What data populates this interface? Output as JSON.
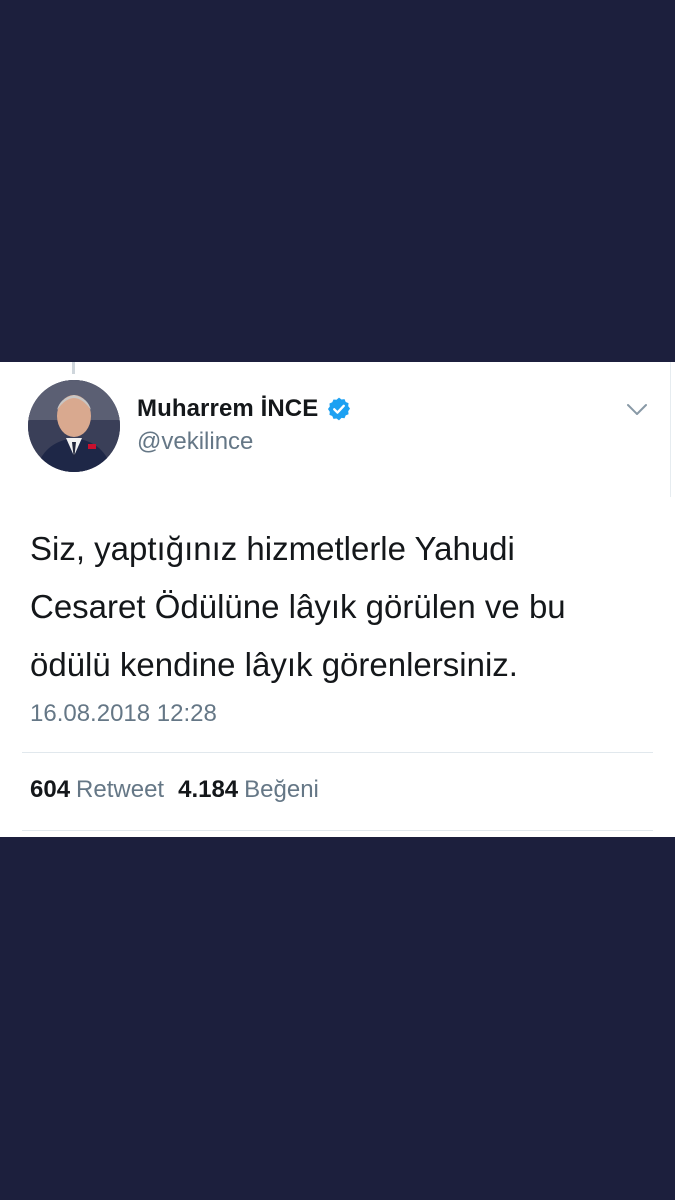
{
  "tweet": {
    "author": {
      "display_name": "Muharrem İNCE",
      "handle": "@vekilince",
      "verified": true,
      "avatar_icon": "avatar-photo"
    },
    "text": "Siz, yaptığınız hizmetlerle Yahudi\nCesaret Ödülüne lâyık görülen ve bu\nödülü kendine lâyık görenlersiniz.",
    "timestamp": "16.08.2018 12:28",
    "stats": {
      "retweets_count": "604",
      "retweets_label": "Retweet",
      "likes_count": "4.184",
      "likes_label": "Beğeni"
    },
    "menu_icon": "chevron-down-icon"
  },
  "colors": {
    "background": "#1c1f3d",
    "card": "#ffffff",
    "text": "#14171a",
    "muted": "#657786",
    "verified": "#1da1f2"
  }
}
